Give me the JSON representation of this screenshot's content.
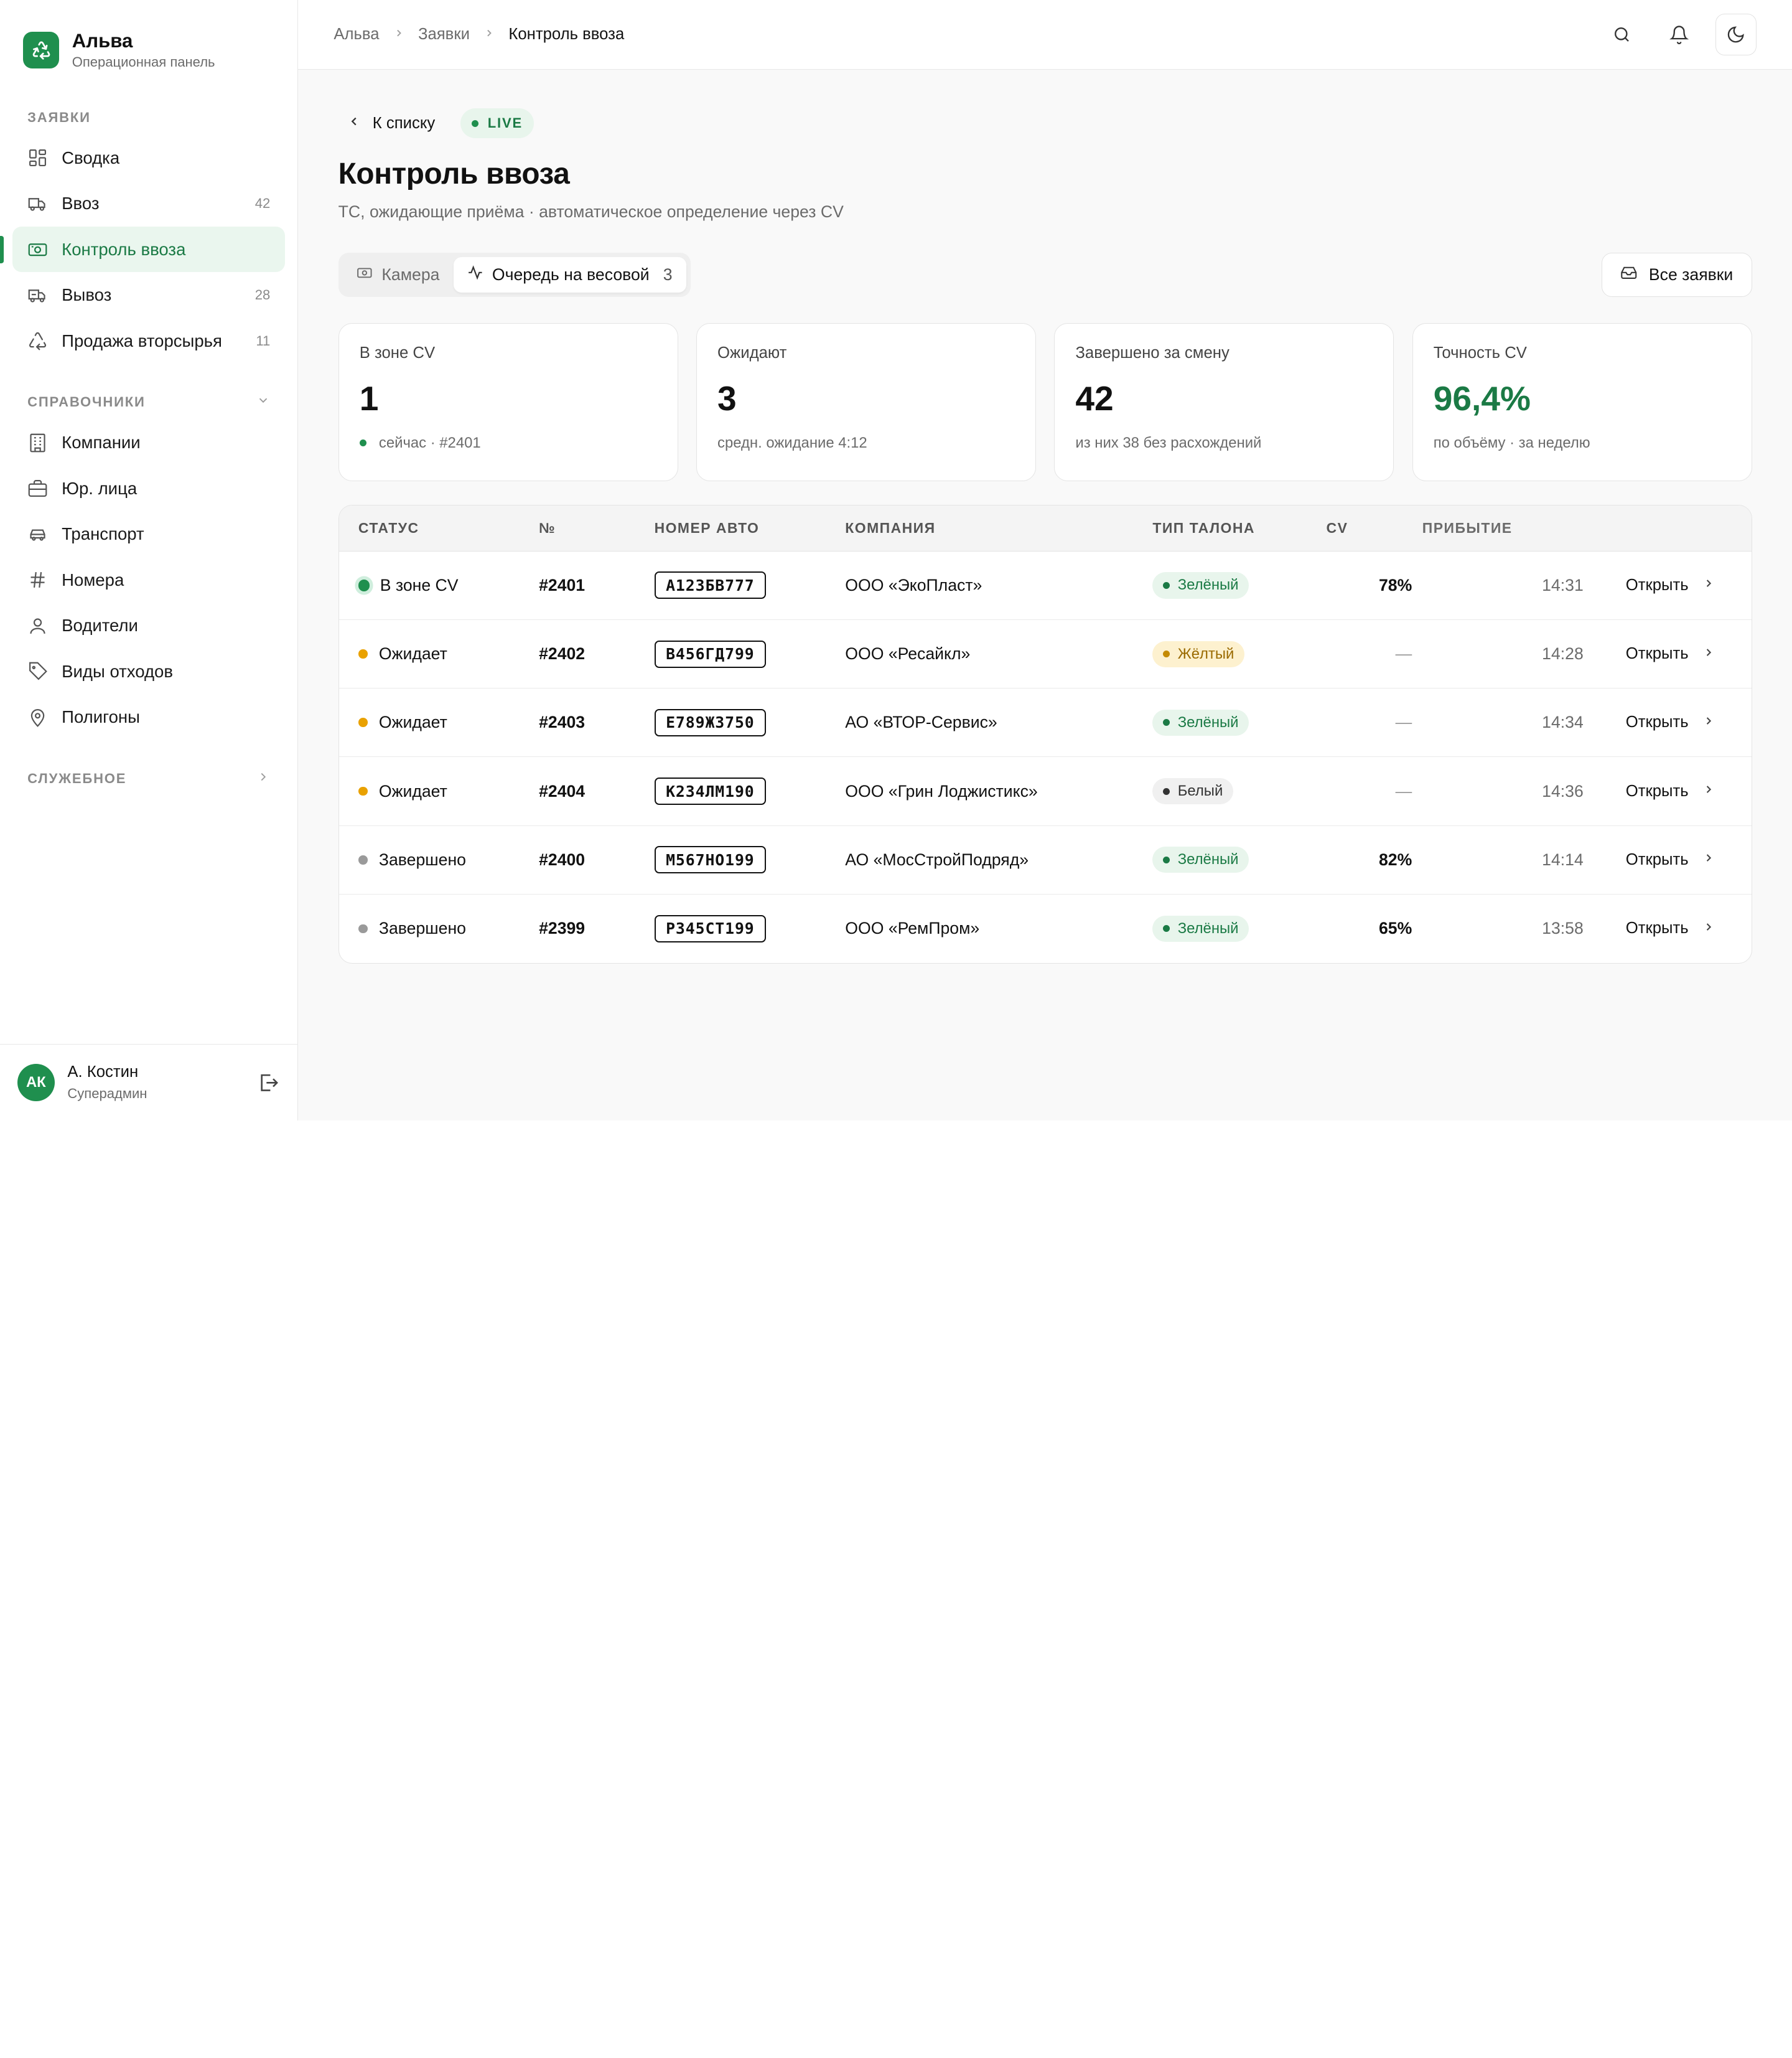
{
  "brand": {
    "title": "Альва",
    "subtitle": "Операционная панель"
  },
  "sidebar": {
    "section1": "ЗАЯВКИ",
    "items1": [
      {
        "label": "Сводка",
        "count": "",
        "icon": "dashboard-icon"
      },
      {
        "label": "Ввоз",
        "count": "42",
        "icon": "truck-in-icon"
      },
      {
        "label": "Контроль ввоза",
        "count": "",
        "icon": "camera-icon",
        "active": true
      },
      {
        "label": "Вывоз",
        "count": "28",
        "icon": "truck-out-icon"
      },
      {
        "label": "Продажа вторсырья",
        "count": "11",
        "icon": "recycle-icon"
      }
    ],
    "section2": "СПРАВОЧНИКИ",
    "items2": [
      {
        "label": "Компании",
        "icon": "building-icon"
      },
      {
        "label": "Юр. лица",
        "icon": "briefcase-icon"
      },
      {
        "label": "Транспорт",
        "icon": "car-icon"
      },
      {
        "label": "Номера",
        "icon": "hash-icon"
      },
      {
        "label": "Водители",
        "icon": "user-icon"
      },
      {
        "label": "Виды отходов",
        "icon": "tag-icon"
      },
      {
        "label": "Полигоны",
        "icon": "map-pin-icon"
      }
    ],
    "section3": "СЛУЖЕБНОЕ"
  },
  "user": {
    "initials": "АК",
    "name": "А. Костин",
    "role": "Суперадмин"
  },
  "breadcrumbs": [
    "Альва",
    "Заявки",
    "Контроль ввоза"
  ],
  "page": {
    "back": "К списку",
    "live": "LIVE",
    "title": "Контроль ввоза",
    "subtitle": "ТС, ожидающие приёма · автоматическое определение через CV"
  },
  "tabs": [
    {
      "label": "Камера",
      "badge": ""
    },
    {
      "label": "Очередь на весовой",
      "badge": "3"
    }
  ],
  "all_requests": "Все заявки",
  "stats": [
    {
      "label": "В зоне CV",
      "value": "1",
      "note": "сейчас · #2401"
    },
    {
      "label": "Ожидают",
      "value": "3",
      "note": "средн. ожидание 4:12"
    },
    {
      "label": "Завершено за смену",
      "value": "42",
      "note": "из них 38 без расхождений"
    },
    {
      "label": "Точность CV",
      "value": "96,4%",
      "note": "по объёму · за неделю"
    }
  ],
  "table": {
    "headers": [
      "СТАТУС",
      "№",
      "НОМЕР АВТО",
      "КОМПАНИЯ",
      "ТИП ТАЛОНА",
      "CV",
      "ПРИБЫТИЕ"
    ],
    "open_label": "Открыть",
    "rows": [
      {
        "status": "В зоне CV",
        "num": "#2401",
        "plate": "А123БВ777",
        "company": "ООО «ЭкоПласт»",
        "type": "Зелёный",
        "cv": "78%",
        "arrival": "14:31"
      },
      {
        "status": "Ожидает",
        "num": "#2402",
        "plate": "В456ГД799",
        "company": "ООО «Ресайкл»",
        "type": "Жёлтый",
        "cv": "—",
        "arrival": "14:28"
      },
      {
        "status": "Ожидает",
        "num": "#2403",
        "plate": "Е789ЖЗ750",
        "company": "АО «ВТОР-Сервис»",
        "type": "Зелёный",
        "cv": "—",
        "arrival": "14:34"
      },
      {
        "status": "Ожидает",
        "num": "#2404",
        "plate": "К234ЛМ190",
        "company": "ООО «Грин Лоджистикс»",
        "type": "Белый",
        "cv": "—",
        "arrival": "14:36"
      },
      {
        "status": "Завершено",
        "num": "#2400",
        "plate": "М567НО199",
        "company": "АО «МосСтройПодряд»",
        "type": "Зелёный",
        "cv": "82%",
        "arrival": "14:14"
      },
      {
        "status": "Завершено",
        "num": "#2399",
        "plate": "Р345СТ199",
        "company": "ООО «РемПром»",
        "type": "Зелёный",
        "cv": "65%",
        "arrival": "13:58"
      }
    ]
  },
  "colors": {
    "accent": "#1f8f4e",
    "waiting": "#e9a100",
    "done": "#9a9a9a"
  }
}
